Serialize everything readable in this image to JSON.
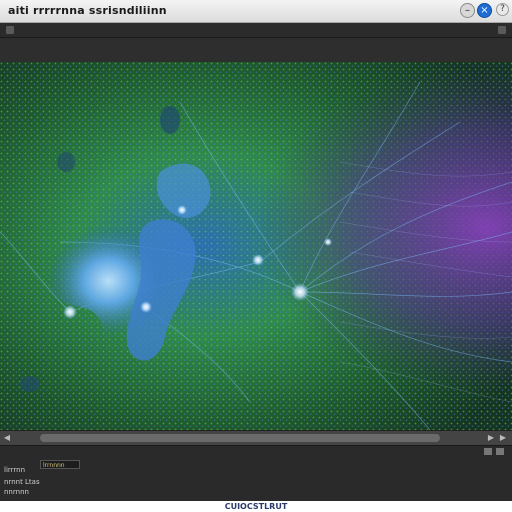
{
  "window": {
    "title": "aiti rrrrrnna ssrisndiliinn",
    "minimize_glyph": "–",
    "close_glyph": "×",
    "help_glyph": "?"
  },
  "status": {
    "field_value": "lrrnnnn",
    "line1": "lirrrnn",
    "line2": "nrnnt Ltas",
    "line3": "nnrnnn"
  },
  "scroll": {
    "left_glyph": "◀",
    "right_glyph": "▶",
    "right2_glyph": "▶"
  },
  "footer": {
    "caption": "CUIOCSTLRUT"
  },
  "colors": {
    "accent": "#1f6ed6",
    "canvas_green": "#3a9a3a",
    "canvas_blue": "#4fa0e6",
    "canvas_purple": "#7a3fb0"
  },
  "icons": {
    "close": "close-icon",
    "minimize": "minimize-icon",
    "help": "help-icon"
  }
}
